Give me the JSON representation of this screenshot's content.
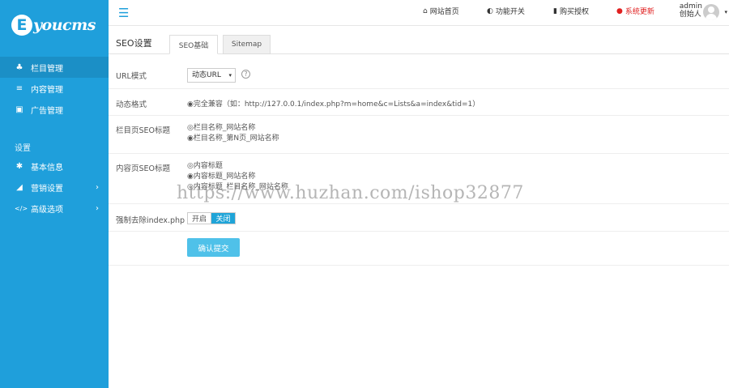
{
  "logo": {
    "letter": "E",
    "text": "youcms"
  },
  "sidebar": {
    "items": [
      {
        "icon": "sitemap-icon",
        "glyph": "♣",
        "label": "栏目管理"
      },
      {
        "icon": "list-icon",
        "glyph": "≡",
        "label": "内容管理"
      },
      {
        "icon": "image-icon",
        "glyph": "▣",
        "label": "广告管理"
      }
    ],
    "section_label": "设置",
    "settings_items": [
      {
        "icon": "gear-icon",
        "glyph": "✱",
        "label": "基本信息",
        "arrow": ""
      },
      {
        "icon": "send-icon",
        "glyph": "◢",
        "label": "营销设置",
        "arrow": "›"
      },
      {
        "icon": "code-icon",
        "glyph": "</>",
        "label": "高级选项",
        "arrow": "›"
      }
    ]
  },
  "topbar": {
    "menu_glyph": "☰",
    "links": [
      {
        "icon": "home-icon",
        "glyph": "⌂",
        "label": "网站首页"
      },
      {
        "icon": "toggle-icon",
        "glyph": "◐",
        "label": "功能开关"
      },
      {
        "icon": "bookmark-icon",
        "glyph": "▮",
        "label": "购买授权"
      },
      {
        "icon": "alert-icon",
        "glyph": "●",
        "label": "系统更新"
      }
    ],
    "user_name": "admin",
    "user_role": "创始人",
    "caret": "▾"
  },
  "page": {
    "title": "SEO设置",
    "tabs": [
      "SEO基础",
      "Sitemap"
    ]
  },
  "form": {
    "url_mode": {
      "label": "URL模式",
      "value": "动态URL",
      "caret": "▾",
      "help": "?"
    },
    "dynamic_format": {
      "label": "动态格式",
      "value": "◉完全兼容（如：http://127.0.0.1/index.php?m=home&c=Lists&a=index&tid=1）"
    },
    "list_seo_title": {
      "label": "栏目页SEO标题",
      "options": [
        "◎栏目名称_网站名称",
        "◉栏目名称_第N页_网站名称"
      ]
    },
    "content_seo_title": {
      "label": "内容页SEO标题",
      "options": [
        "◎内容标题",
        "◉内容标题_网站名称",
        "◎内容标题_栏目名称_网站名称"
      ]
    },
    "remove_index": {
      "label": "强制去除index.php",
      "off": "开启",
      "on": "关闭"
    },
    "submit": "确认提交"
  },
  "watermark": "https://www.huzhan.com/ishop32877"
}
